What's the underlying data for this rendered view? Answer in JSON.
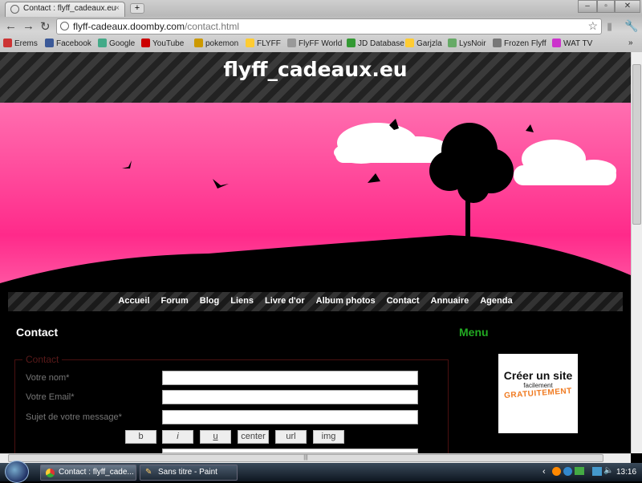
{
  "browser": {
    "tab_title": "Contact : flyff_cadeaux.eu",
    "url_host": "flyff-cadeaux.doomby.com",
    "url_path": "/contact.html",
    "bookmarks": [
      {
        "label": "Erems",
        "color": "#c33"
      },
      {
        "label": "Facebook",
        "color": "#3b5998"
      },
      {
        "label": "Google",
        "color": "#4a8"
      },
      {
        "label": "YouTube",
        "color": "#c00"
      },
      {
        "label": "pokemon",
        "color": "#c90"
      },
      {
        "label": "FLYFF",
        "color": "#fc3"
      },
      {
        "label": "FlyFF World",
        "color": "#999"
      },
      {
        "label": "JD Database",
        "color": "#393"
      },
      {
        "label": "Garjzla",
        "color": "#fc3"
      },
      {
        "label": "LysNoir",
        "color": "#6a6"
      },
      {
        "label": "Frozen Flyff",
        "color": "#777"
      },
      {
        "label": "WAT TV",
        "color": "#c3c"
      }
    ],
    "overflow": "»"
  },
  "site": {
    "title": "flyff_cadeaux.eu",
    "nav": [
      "Accueil",
      "Forum",
      "Blog",
      "Liens",
      "Livre d'or",
      "Album photos",
      "Contact",
      "Annuaire",
      "Agenda"
    ]
  },
  "content": {
    "title": "Contact",
    "legend": "Contact",
    "fields": [
      {
        "label": "Votre nom*",
        "value": ""
      },
      {
        "label": "Votre Email*",
        "value": ""
      },
      {
        "label": "Sujet de votre message*",
        "value": ""
      }
    ],
    "format_buttons": [
      "b",
      "i",
      "u",
      "center",
      "url",
      "img"
    ]
  },
  "sidebar": {
    "menu_title": "Menu",
    "ad": {
      "line1": "Créer un site",
      "line2": "facilement",
      "line3": "GRATUITEMENT"
    }
  },
  "taskbar": {
    "tasks": [
      "Contact : flyff_cade...",
      "Sans titre - Paint"
    ],
    "clock": "13:16"
  },
  "colors": {
    "banner_pink": "#ff3d96",
    "menu_green": "#22aa22"
  }
}
